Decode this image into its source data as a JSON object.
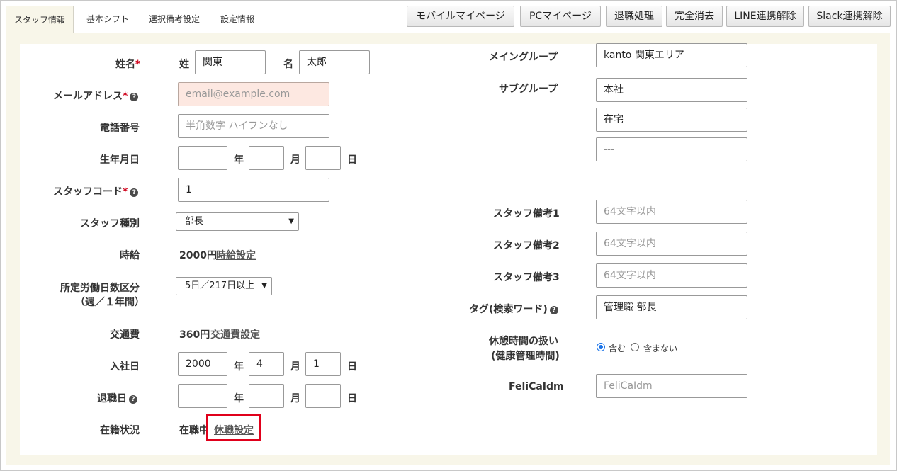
{
  "tabs": [
    "スタッフ情報",
    "基本シフト",
    "選択備考設定",
    "設定情報"
  ],
  "top_buttons": [
    "モバイルマイページ",
    "PCマイページ",
    "退職処理",
    "完全消去",
    "LINE連携解除",
    "Slack連携解除"
  ],
  "left": {
    "name_label": "姓名",
    "last_name_prefix": "姓",
    "last_name_value": "関東",
    "first_name_prefix": "名",
    "first_name_value": "太郎",
    "email_label": "メールアドレス",
    "email_placeholder": "email@example.com",
    "phone_label": "電話番号",
    "phone_placeholder": "半角数字 ハイフンなし",
    "birth_label": "生年月日",
    "unit_year": "年",
    "unit_month": "月",
    "unit_day": "日",
    "staff_code_label": "スタッフコード",
    "staff_code_value": "1",
    "staff_type_label": "スタッフ種別",
    "staff_type_value": "部長",
    "hourly_label": "時給",
    "hourly_value": "2000円",
    "hourly_link": "時給設定",
    "workdays_label_1": "所定労働日数区分",
    "workdays_label_2": "（週／１年間）",
    "workdays_value": "5日／217日以上",
    "transport_label": "交通費",
    "transport_value": "360円",
    "transport_link": "交通費設定",
    "hire_label": "入社日",
    "hire_year": "2000",
    "hire_month": "4",
    "hire_day": "1",
    "retire_label": "退職日",
    "status_label": "在籍状況",
    "status_value": "在職中",
    "leave_link": "休職設定"
  },
  "right": {
    "main_group_label": "メイングループ",
    "main_group_value": "kanto 関東エリア",
    "sub_group_label": "サブグループ",
    "sub_group_1": "本社",
    "sub_group_2": "在宅",
    "sub_group_3": "---",
    "note1_label": "スタッフ備考1",
    "note2_label": "スタッフ備考2",
    "note3_label": "スタッフ備考3",
    "note_placeholder": "64文字以内",
    "tag_label": "タグ(検索ワード)",
    "tag_value": "管理職 部長",
    "break_label_1": "休憩時間の扱い",
    "break_label_2": "(健康管理時間)",
    "break_opt_include": "含む",
    "break_opt_exclude": "含まない",
    "felica_label": "FeliCaIdm",
    "felica_placeholder": "FeliCaIdm"
  },
  "required_mark": "*",
  "help_glyph": "?",
  "colors": {
    "accent_red": "#e0001b",
    "page_bg": "#f8f6e9",
    "error_field_bg": "#fde8e1",
    "radio_blue": "#1a73e8"
  }
}
